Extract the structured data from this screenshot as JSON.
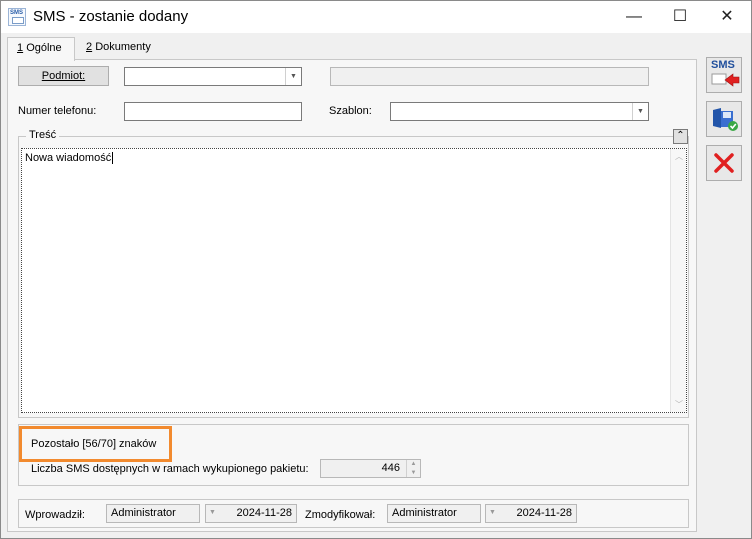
{
  "window": {
    "title": "SMS - zostanie dodany",
    "minimize_glyph": "—",
    "maximize_glyph": "☐",
    "close_glyph": "✕",
    "app_icon_text": "SMS"
  },
  "tabs": [
    {
      "hotkey": "1",
      "label": "Ogólne"
    },
    {
      "hotkey": "2",
      "label": "Dokumenty"
    }
  ],
  "form": {
    "podmiot_button": "Podmiot:",
    "podmiot_value": "",
    "podmiot_name_value": "",
    "phone_label": "Numer telefonu:",
    "phone_value": "",
    "szablon_label": "Szablon:",
    "szablon_value": "",
    "tresc_label": "Treść",
    "message_text": "Nowa wiadomość",
    "remaining_text": "Pozostało [56/70] znaków",
    "sms_available_label": "Liczba SMS dostępnych w ramach wykupionego pakietu:",
    "sms_available_value": "446"
  },
  "footer": {
    "entered_label": "Wprowadził:",
    "entered_user": "Administrator",
    "entered_date": "2024-11-28",
    "modified_label": "Zmodyfikował:",
    "modified_user": "Administrator",
    "modified_date": "2024-11-28"
  },
  "side_buttons": {
    "sms_text": "SMS"
  },
  "colors": {
    "highlight": "#f28a2e",
    "cancel": "#e02020"
  }
}
